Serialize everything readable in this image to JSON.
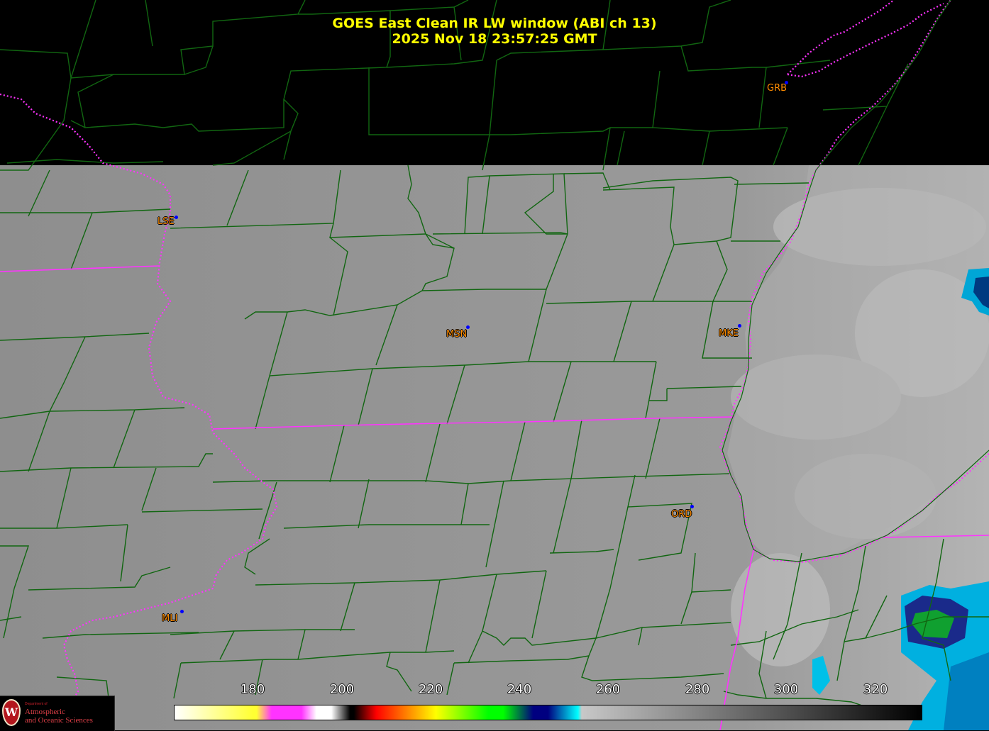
{
  "header": {
    "title": "GOES East Clean IR LW window (ABI ch 13)",
    "timestamp": "2025 Nov 18  23:57:25 GMT"
  },
  "stations": [
    {
      "code": "GRB"
    },
    {
      "code": "LSE"
    },
    {
      "code": "MSN"
    },
    {
      "code": "MKE"
    },
    {
      "code": "ORD"
    },
    {
      "code": "MLI"
    }
  ],
  "colorbar": {
    "ticks": [
      "180",
      "200",
      "220",
      "240",
      "260",
      "280",
      "300",
      "320"
    ],
    "stops": [
      "#ffffff",
      "#ffff33",
      "#ff33ff",
      "#ffffff",
      "#000000",
      "#ff0000",
      "#ffff00",
      "#00ff00",
      "#000080",
      "#00ffff",
      "#c8c8c8",
      "#000000"
    ]
  },
  "legend_logo": {
    "dept": "Department of",
    "line1": "Atmospheric",
    "line2": "and Oceanic Sciences"
  },
  "colors": {
    "county_lines": "#116611",
    "state_lines": "#ff33ff",
    "title": "#ffff00",
    "station_label": "#ff8c00",
    "station_dot": "#0000ff"
  }
}
